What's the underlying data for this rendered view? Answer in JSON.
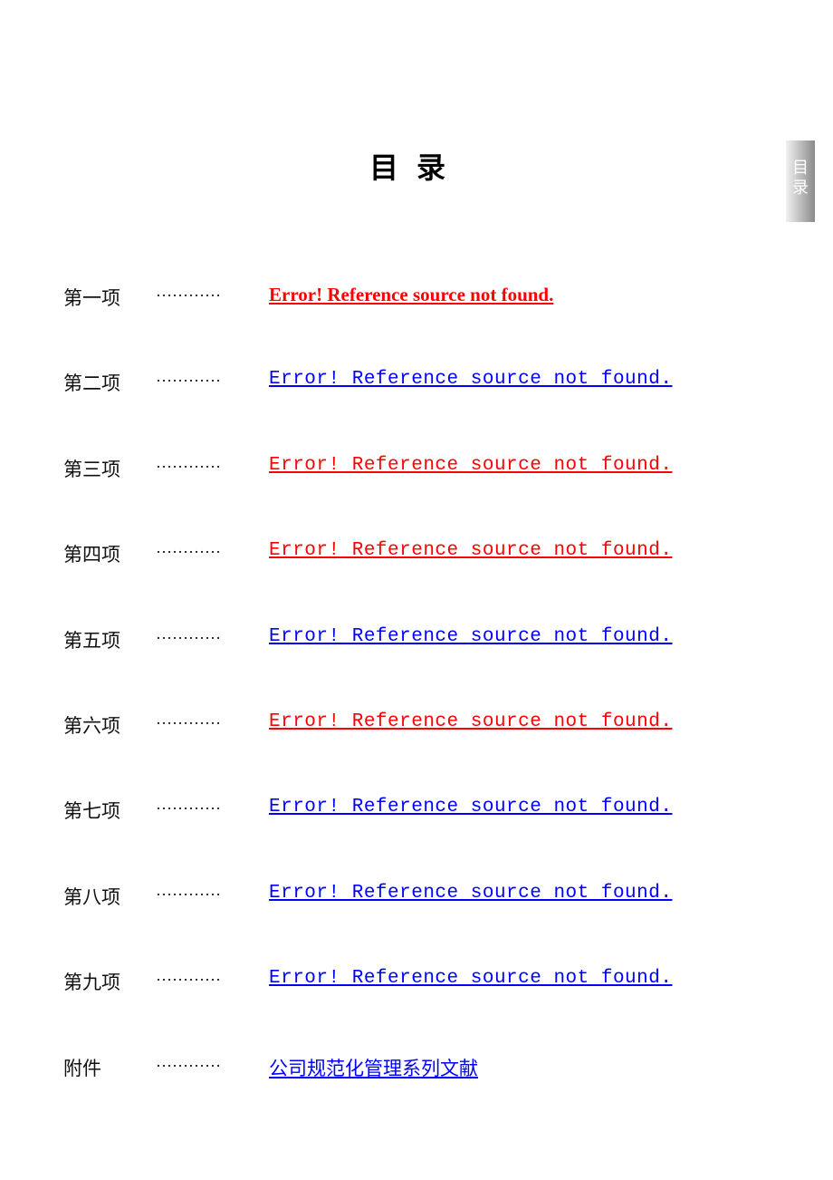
{
  "document": {
    "title": "目录",
    "side_tab_chars": [
      "目",
      "录"
    ]
  },
  "colors": {
    "link_red": "#ff0000",
    "link_blue": "#0000ff"
  },
  "toc": [
    {
      "label": "第一项",
      "dots": "…………",
      "link": "Error! Reference source not found.",
      "color": "#ff0000",
      "style": "bold"
    },
    {
      "label": "第二项",
      "dots": "…………",
      "link": "Error! Reference source not found.",
      "color": "#0000ff",
      "style": "mono"
    },
    {
      "label": "第三项",
      "dots": "…………",
      "link": "Error! Reference source not found.",
      "color": "#ff0000",
      "style": "mono"
    },
    {
      "label": "第四项",
      "dots": "…………",
      "link": "Error! Reference source not found.",
      "color": "#ff0000",
      "style": "mono"
    },
    {
      "label": "第五项",
      "dots": "…………",
      "link": "Error! Reference source not found.",
      "color": "#0000ff",
      "style": "mono"
    },
    {
      "label": "第六项",
      "dots": "…………",
      "link": "Error! Reference source not found.",
      "color": "#ff0000",
      "style": "mono"
    },
    {
      "label": "第七项",
      "dots": "…………",
      "link": "Error! Reference source not found.",
      "color": "#0000ff",
      "style": "mono"
    },
    {
      "label": "第八项",
      "dots": "…………",
      "link": "Error! Reference source not found.",
      "color": "#0000ff",
      "style": "mono"
    },
    {
      "label": "第九项",
      "dots": "…………",
      "link": "Error! Reference source not found.",
      "color": "#0000ff",
      "style": "mono"
    },
    {
      "label": "附件",
      "dots": "…………",
      "link": "公司规范化管理系列文献",
      "color": "#0000ff",
      "style": "cjk"
    }
  ]
}
